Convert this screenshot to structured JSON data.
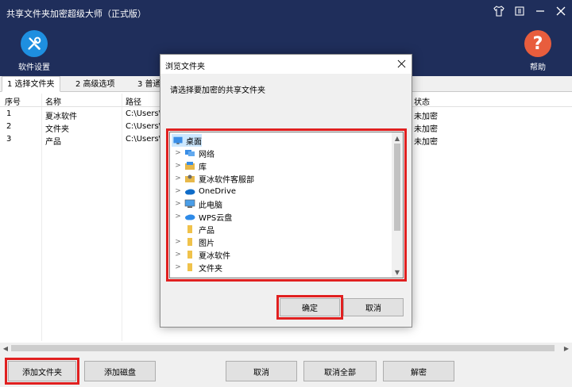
{
  "app": {
    "title": "共享文件夹加密超级大师（正式版）",
    "settings_label": "软件设置",
    "help_label": "帮助"
  },
  "tabs": [
    {
      "label": "1 选择文件夹",
      "active": true
    },
    {
      "label": "2 高级选项",
      "active": false
    },
    {
      "label": "3 普通",
      "active": false
    }
  ],
  "table": {
    "headers": {
      "num": "序号",
      "name": "名称",
      "path": "路径",
      "status": "状态"
    },
    "rows": [
      {
        "num": "1",
        "name": "夏冰软件",
        "path": "C:\\Users\\",
        "status": "未加密"
      },
      {
        "num": "2",
        "name": "文件夹",
        "path": "C:\\Users\\",
        "status": "未加密"
      },
      {
        "num": "3",
        "name": "产品",
        "path": "C:\\Users\\",
        "status": "未加密"
      }
    ]
  },
  "bottom_buttons": {
    "add_folder": "添加文件夹",
    "add_disk": "添加磁盘",
    "cancel": "取消",
    "cancel_all": "取消全部",
    "decrypt": "解密"
  },
  "dialog": {
    "title": "浏览文件夹",
    "prompt": "请选择要加密的共享文件夹",
    "tree": [
      {
        "label": "桌面",
        "icon": "desktop-icon"
      },
      {
        "label": "网络",
        "icon": "network-icon"
      },
      {
        "label": "库",
        "icon": "library-icon"
      },
      {
        "label": "夏冰软件客服部",
        "icon": "user-folder-icon"
      },
      {
        "label": "OneDrive",
        "icon": "cloud-icon"
      },
      {
        "label": "此电脑",
        "icon": "computer-icon"
      },
      {
        "label": "WPS云盘",
        "icon": "cloud-icon"
      },
      {
        "label": "产品",
        "icon": "folder-icon"
      },
      {
        "label": "图片",
        "icon": "folder-icon"
      },
      {
        "label": "夏冰软件",
        "icon": "folder-icon"
      },
      {
        "label": "文件夹",
        "icon": "folder-icon"
      }
    ],
    "ok_label": "确定",
    "cancel_label": "取消"
  },
  "colors": {
    "header_bg": "#1f2e5b",
    "highlight_red": "#e02020",
    "selection_blue": "#cce8ff"
  }
}
